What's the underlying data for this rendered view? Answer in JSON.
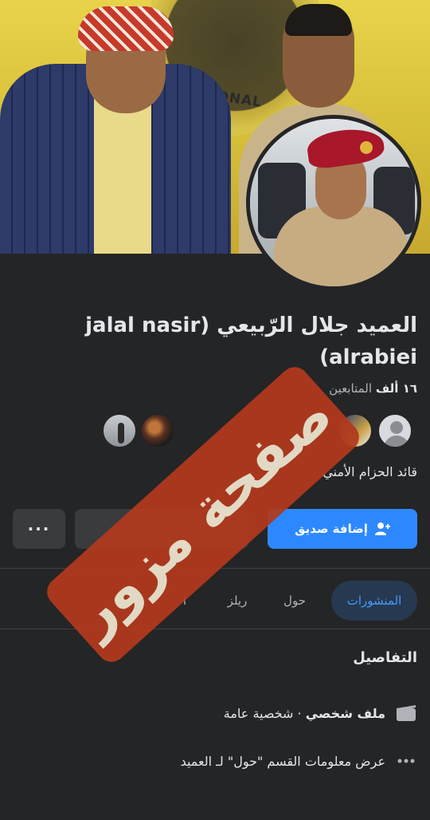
{
  "cover": {
    "emblem_text": "SITIONAL"
  },
  "profile": {
    "name": "العميد جلال الرّبيعي (jalal nasir alrabiei)",
    "followers_count": "١٦ ألف",
    "followers_label": "المتابعين",
    "bio": "قائد الحزام الأمني"
  },
  "actions": {
    "add_friend_label": "إضافة صديق",
    "more_label": "···"
  },
  "tabs": [
    {
      "label": "المنشورات",
      "active": true
    },
    {
      "label": "حول",
      "active": false
    },
    {
      "label": "ريلز",
      "active": false
    },
    {
      "label": "ا",
      "active": false
    }
  ],
  "details": {
    "title": "التفاصيل",
    "profile_type_bold": "ملف شخصي",
    "profile_type_rest": "· شخصية عامة",
    "about_link": "عرض معلومات القسم \"حول\" لـ العميد"
  },
  "stamp_text": "صفحة مزور",
  "colors": {
    "accent": "#2d88ff",
    "background": "#242526",
    "stamp": "#b2391d"
  }
}
